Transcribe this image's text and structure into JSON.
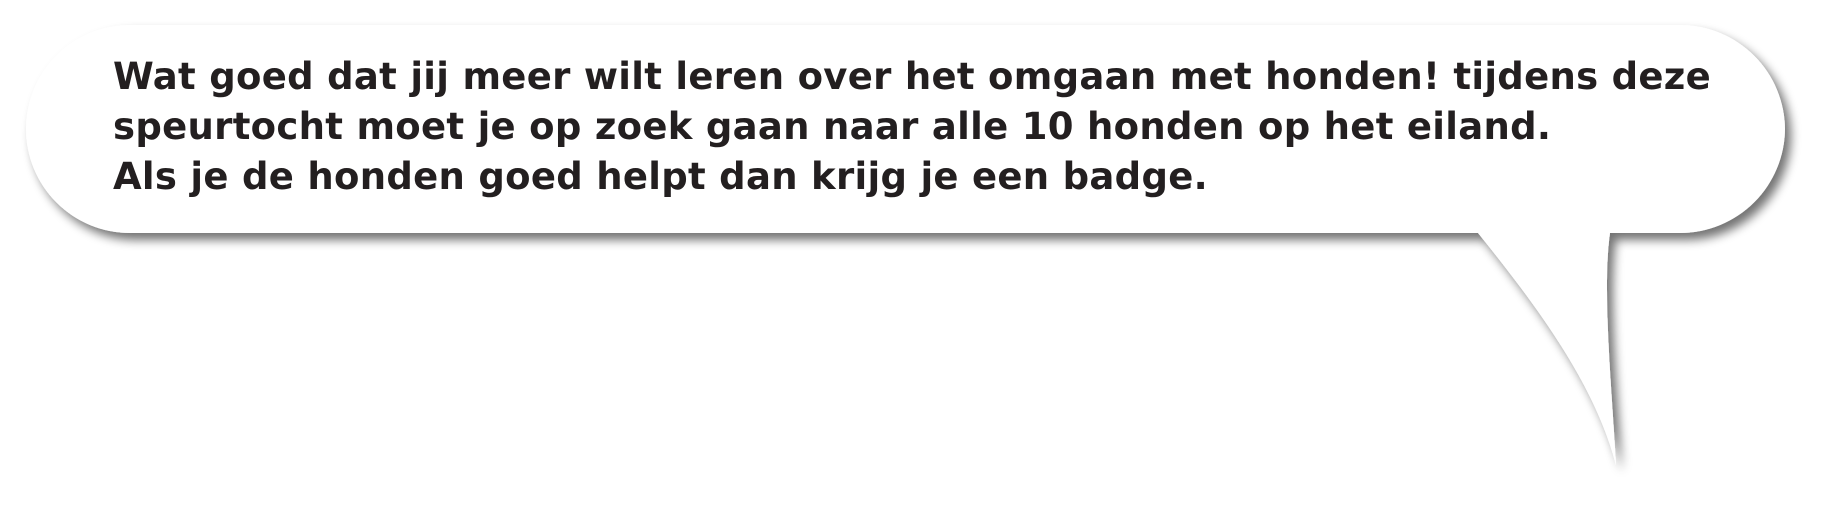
{
  "speech_bubble": {
    "lines": [
      "Wat goed dat jij meer wilt leren over het omgaan met honden! tijdens deze",
      "speurtocht moet je op zoek gaan naar alle 10 honden op het eiland.",
      "Als je de honden goed helpt dan krijg je een badge."
    ],
    "fill_color": "#ffffff",
    "text_color": "#231f20",
    "shadow_color": "#7a7a7a"
  }
}
